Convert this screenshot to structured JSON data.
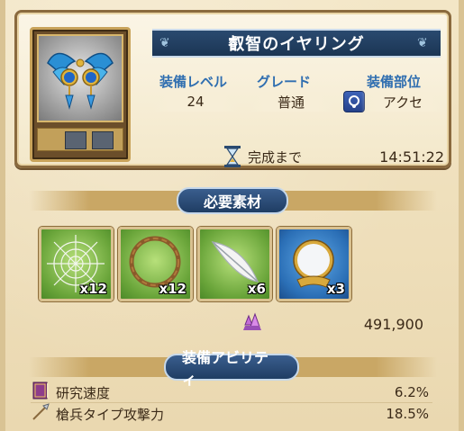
{
  "item": {
    "name": "叡智のイヤリング",
    "icon": "earring-item-icon"
  },
  "stats": {
    "level_label": "装備レベル",
    "level_value": "24",
    "grade_label": "グレード",
    "grade_value": "普通",
    "slot_label": "装備部位",
    "slot_value": "アクセ",
    "slot_icon": "accessory-icon"
  },
  "timer": {
    "label": "完成まで",
    "value": "14:51:22"
  },
  "materials": {
    "title": "必要素材",
    "items": [
      {
        "icon": "spider-web-icon",
        "qty": "x12"
      },
      {
        "icon": "vine-ring-icon",
        "qty": "x12"
      },
      {
        "icon": "feather-icon",
        "qty": "x6"
      },
      {
        "icon": "mirror-icon",
        "qty": "x3"
      }
    ],
    "cost_icon": "crystal-icon",
    "cost_value": "491,900"
  },
  "abilities": {
    "title": "装備アビリティ",
    "items": [
      {
        "icon": "book-icon",
        "name": "研究速度",
        "value": "6.2%"
      },
      {
        "icon": "spear-icon",
        "name": "槍兵タイプ攻撃力",
        "value": "18.5%"
      }
    ]
  },
  "colors": {
    "accent_blue": "#2f6eb0",
    "banner": "#1f3d63",
    "parchment": "#efe0bd"
  }
}
